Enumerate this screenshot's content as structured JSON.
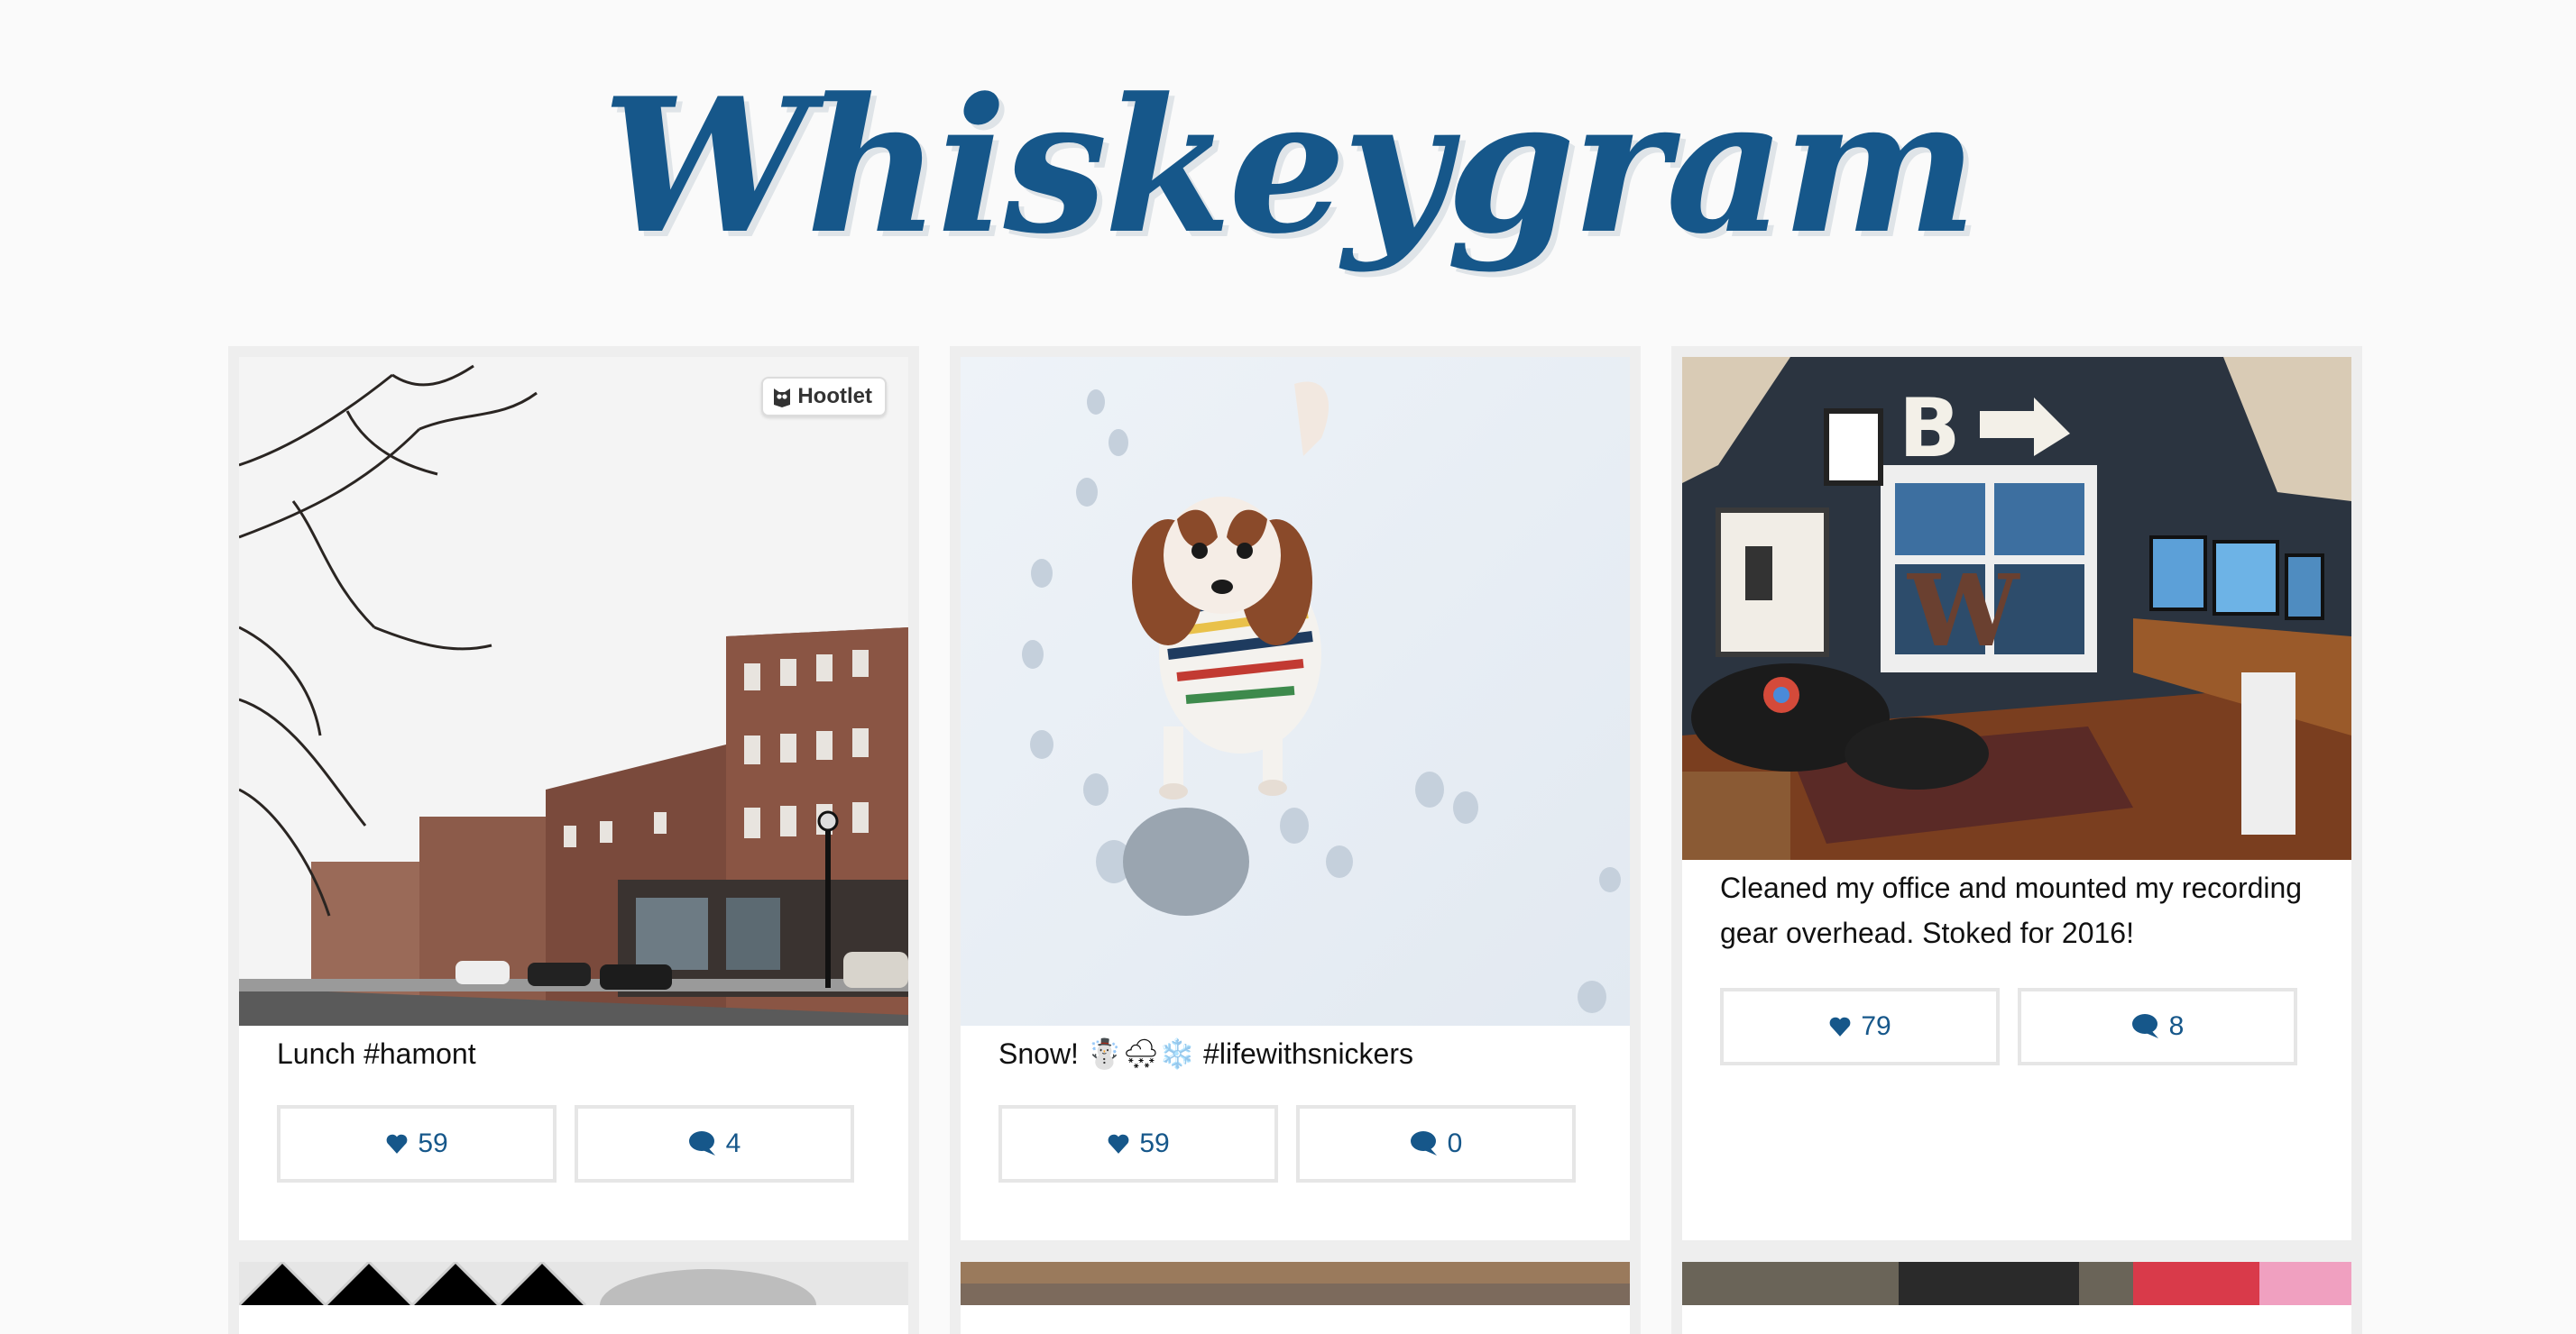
{
  "site": {
    "title": "Whiskeygram"
  },
  "posts": [
    {
      "caption": "Lunch #hamont",
      "likes": "59",
      "comments": "4",
      "overlay_label": "Hootlet"
    },
    {
      "caption": "Snow! ☃️🌨❄️ #lifewithsnickers",
      "likes": "59",
      "comments": "0"
    },
    {
      "caption": "Cleaned my office and mounted my recording gear overhead. Stoked for 2016!",
      "likes": "79",
      "comments": "8"
    }
  ],
  "icons": {
    "like": "heart-icon",
    "comment": "speech-bubble-icon",
    "overlay": "owl-icon"
  },
  "colors": {
    "accent": "#16578a",
    "background": "#fafafa",
    "card_border": "#eeeeee"
  }
}
